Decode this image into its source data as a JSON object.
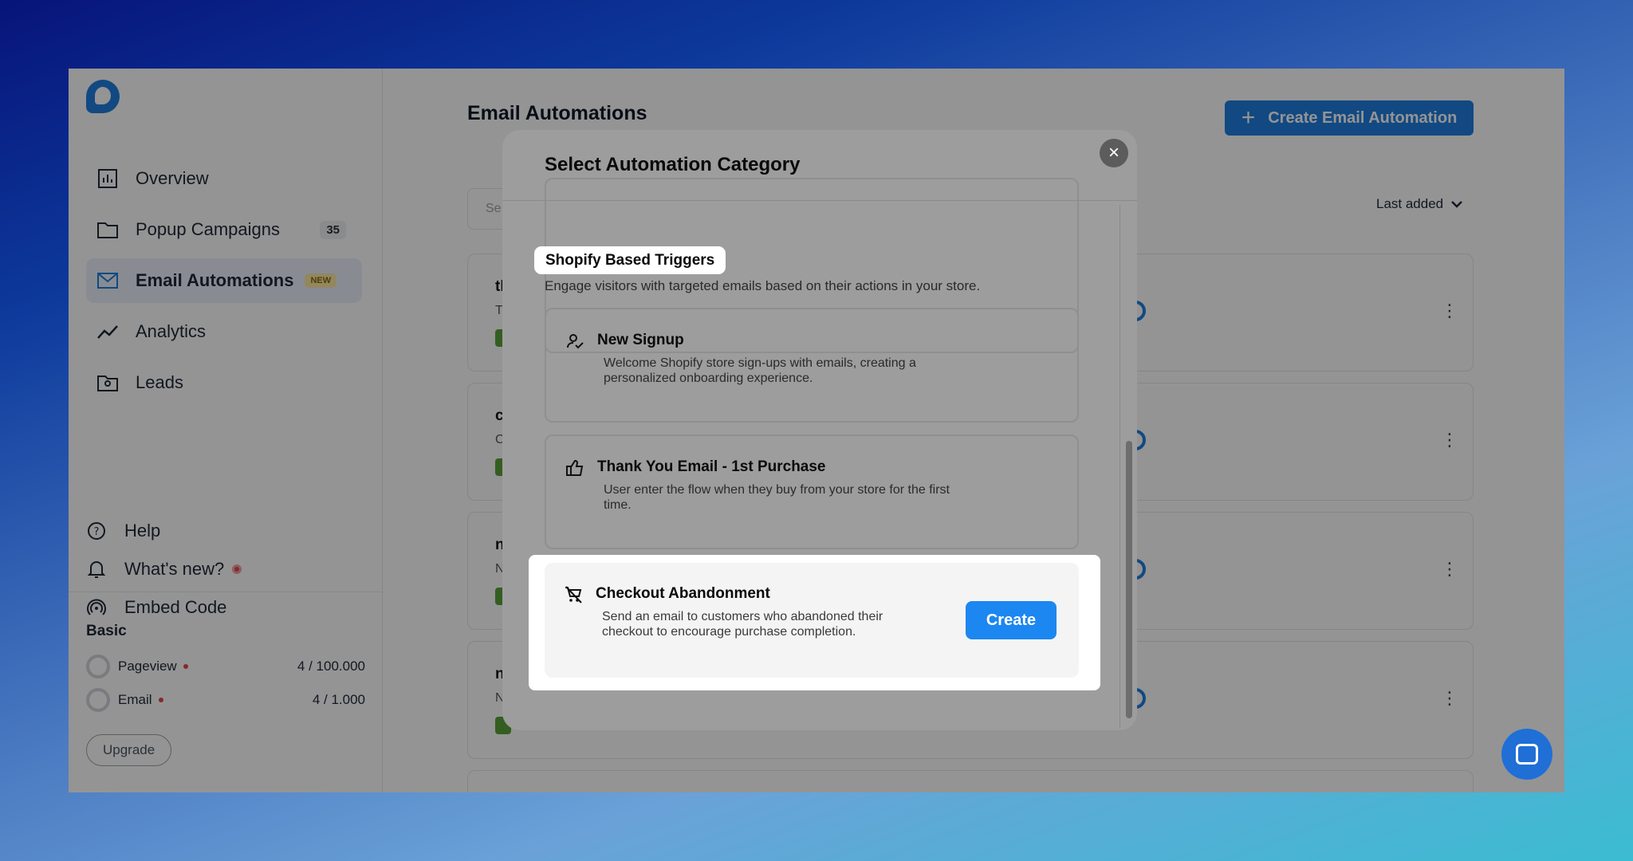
{
  "sidebar": {
    "nav": [
      {
        "label": "Overview",
        "icon": "chart-icon"
      },
      {
        "label": "Popup Campaigns",
        "icon": "folder-icon",
        "count": "35"
      },
      {
        "label": "Email Automations",
        "icon": "mail-icon",
        "badge": "NEW"
      },
      {
        "label": "Analytics",
        "icon": "trend-icon"
      },
      {
        "label": "Leads",
        "icon": "contact-folder-icon"
      }
    ],
    "secondary": [
      {
        "label": "Help",
        "icon": "help-icon"
      },
      {
        "label": "What's new?",
        "icon": "bell-icon"
      },
      {
        "label": "Embed Code",
        "icon": "broadcast-icon"
      }
    ],
    "plan": {
      "title": "Basic",
      "usage": [
        {
          "label": "Pageview",
          "value": "4 / 100.000"
        },
        {
          "label": "Email",
          "value": "4 / 1.000"
        }
      ],
      "upgrade_label": "Upgrade"
    }
  },
  "main": {
    "title": "Email Automations",
    "create_label": "Create Email Automation",
    "search_placeholder": "Se",
    "sort_label": "Last added",
    "cards": [
      {
        "title": "th",
        "sub": "T"
      },
      {
        "title": "c",
        "sub": "C"
      },
      {
        "title": "n",
        "sub": "N"
      },
      {
        "title": "n",
        "sub": "N"
      }
    ]
  },
  "modal": {
    "title": "Select Automation Category",
    "close_symbol": "×",
    "section_title": "Shopify Based Triggers",
    "section_desc": "Engage visitors with targeted emails based on their actions in your store.",
    "items": [
      {
        "title": "New Signup",
        "desc": "Welcome Shopify store sign-ups with emails, creating a personalized onboarding experience.",
        "icon": "user-check-icon"
      },
      {
        "title": "Thank You Email - 1st Purchase",
        "desc": "User enter the flow when they buy from your store for the first time.",
        "icon": "thumbs-up-icon"
      },
      {
        "title": "Checkout Abandonment",
        "desc": "Send an email to customers who abandoned their checkout to encourage purchase completion.",
        "icon": "cart-off-icon"
      }
    ],
    "create_label": "Create"
  }
}
